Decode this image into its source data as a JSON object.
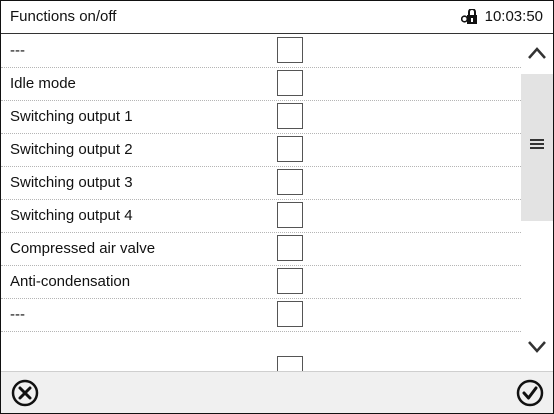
{
  "header": {
    "title": "Functions on/off",
    "time": "10:03:50",
    "lock_icon": "lock-icon"
  },
  "list": {
    "rows": [
      {
        "label": "---",
        "checked": false
      },
      {
        "label": "Idle mode",
        "checked": false
      },
      {
        "label": "Switching output 1",
        "checked": false
      },
      {
        "label": "Switching output 2",
        "checked": false
      },
      {
        "label": "Switching output 3",
        "checked": false
      },
      {
        "label": "Switching output 4",
        "checked": false
      },
      {
        "label": "Compressed air valve",
        "checked": false
      },
      {
        "label": "Anti-condensation",
        "checked": false
      },
      {
        "label": "---",
        "checked": false
      }
    ]
  },
  "scrollbar": {
    "up_icon": "chevron-up-icon",
    "down_icon": "chevron-down-icon",
    "menu_icon": "menu-icon"
  },
  "footer": {
    "cancel_icon": "cancel-circle-icon",
    "ok_icon": "confirm-check-icon"
  }
}
